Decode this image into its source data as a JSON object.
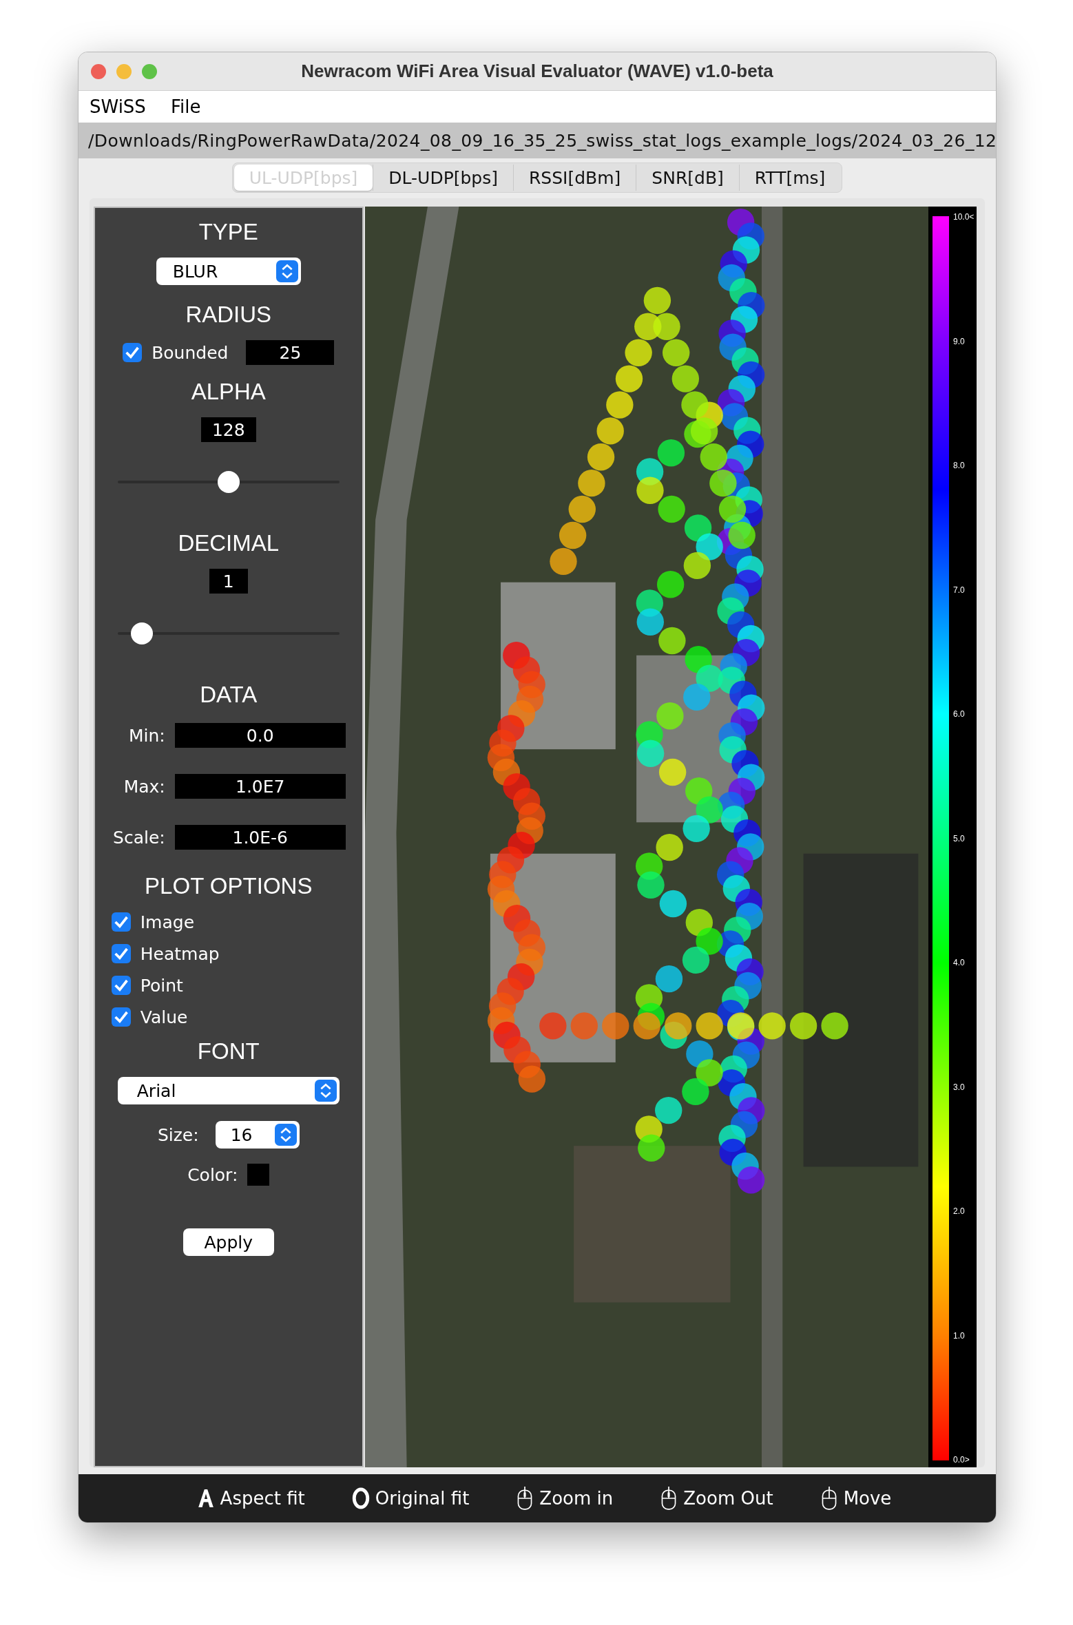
{
  "window": {
    "title": "Newracom WiFi Area Visual Evaluator (WAVE) v1.0-beta"
  },
  "menu": [
    "SWiSS",
    "File"
  ],
  "path": "/Downloads/RingPowerRawData/2024_08_09_16_35_25_swiss_stat_logs_example_logs/2024_03_26_12",
  "tabs": [
    {
      "label": "UL-UDP[bps]",
      "selected": true
    },
    {
      "label": "DL-UDP[bps]",
      "selected": false
    },
    {
      "label": "RSSI[dBm]",
      "selected": false
    },
    {
      "label": "SNR[dB]",
      "selected": false
    },
    {
      "label": "RTT[ms]",
      "selected": false
    }
  ],
  "panel": {
    "type": {
      "heading": "TYPE",
      "value": "BLUR"
    },
    "radius": {
      "heading": "RADIUS",
      "bounded_label": "Bounded",
      "bounded": true,
      "value": "25"
    },
    "alpha": {
      "heading": "ALPHA",
      "value": "128",
      "level": 0.5
    },
    "decimal": {
      "heading": "DECIMAL",
      "value": "1",
      "level": 0.11
    },
    "data": {
      "heading": "DATA",
      "fields": [
        {
          "label": "Min:",
          "value": "0.0"
        },
        {
          "label": "Max:",
          "value": "1.0E7"
        },
        {
          "label": "Scale:",
          "value": "1.0E-6"
        }
      ]
    },
    "plot_options": {
      "heading": "PLOT OPTIONS",
      "options": [
        {
          "label": "Image",
          "checked": true
        },
        {
          "label": "Heatmap",
          "checked": true
        },
        {
          "label": "Point",
          "checked": true
        },
        {
          "label": "Value",
          "checked": true
        }
      ]
    },
    "font": {
      "heading": "FONT",
      "family": "Arial",
      "size_label": "Size:",
      "size": "16",
      "color_label": "Color:",
      "color": "#000000"
    },
    "apply": "Apply"
  },
  "colorbar": {
    "ticks": [
      "10.0<",
      "9.0",
      "8.0",
      "7.0",
      "6.0",
      "5.0",
      "4.0",
      "3.0",
      "2.0",
      "1.0",
      "0.0>"
    ]
  },
  "toolbar": [
    {
      "label": "Aspect fit",
      "kind": "aspect"
    },
    {
      "label": "Original fit",
      "kind": "original"
    },
    {
      "label": "Zoom in",
      "kind": "mouse"
    },
    {
      "label": "Zoom Out",
      "kind": "mouse"
    },
    {
      "label": "Move",
      "kind": "move"
    }
  ]
}
